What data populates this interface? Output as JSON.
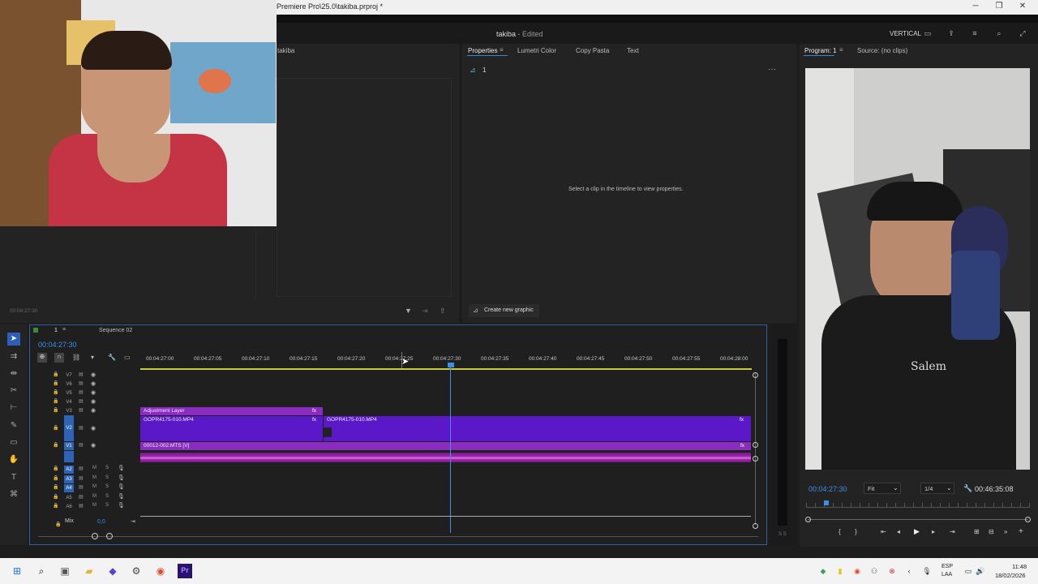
{
  "window": {
    "title": "Premiere Pro\\25.0\\takiba.prproj *",
    "minimize": "─",
    "maximize": "❐",
    "close": "✕"
  },
  "header": {
    "project_title": "takiba",
    "edited": "- Edited",
    "layout_label": "VERTICAL"
  },
  "project_panel": {
    "tab": "takiba",
    "timecode": "00:04:27:30"
  },
  "properties_panel": {
    "tabs": [
      "Properties",
      "Lumetri Color",
      "Copy Pasta",
      "Text"
    ],
    "item_label": "1",
    "empty_message": "Select a clip in the timeline to view properties.",
    "create_graphic": "Create new graphic"
  },
  "program_monitor": {
    "tab": "Program: 1",
    "source_tab": "Source: (no clips)",
    "timecode": "00:04:27:30",
    "fit": "Fit",
    "resolution": "1/4",
    "duration": "00:46:35:08",
    "playhead_fraction": 0.08
  },
  "timeline": {
    "tab": "1",
    "sequence_tab": "Sequence 02",
    "timecode": "00:04:27:30",
    "ruler": [
      "00:04:27:00",
      "00:04:27:05",
      "00:04:27:10",
      "00:04:27:15",
      "00:04:27:20",
      "00:04:27:25",
      "00:04:27:30",
      "00:04:27:35",
      "00:04:27:40",
      "00:04:27:45",
      "00:04:27:50",
      "00:04:27:55",
      "00:04:28:00"
    ],
    "video_tracks": [
      "V7",
      "V6",
      "V5",
      "V4",
      "V3",
      "V2",
      "V1"
    ],
    "audio_tracks": [
      "A2",
      "A3",
      "A4",
      "A5",
      "A6"
    ],
    "mix_label": "Mix",
    "mix_value": "0,0",
    "clips": {
      "adjustment": "Adjustment Layer",
      "gopr_a": "GOPR4175-010.MP4",
      "gopr_b": "GOPR4175-010.MP4",
      "v1": "00012-002.MTS [V]",
      "fx": "fx"
    },
    "meter_label": "S S"
  },
  "taskbar": {
    "lang": "ESP",
    "lang2": "LAA",
    "time": "11:48",
    "date": "18/02/2026"
  },
  "colors": {
    "accent": "#3a84d6",
    "clip_purple": "#8a2cc0",
    "clip_violet": "#5a18c8",
    "audio": "#a226b8"
  }
}
